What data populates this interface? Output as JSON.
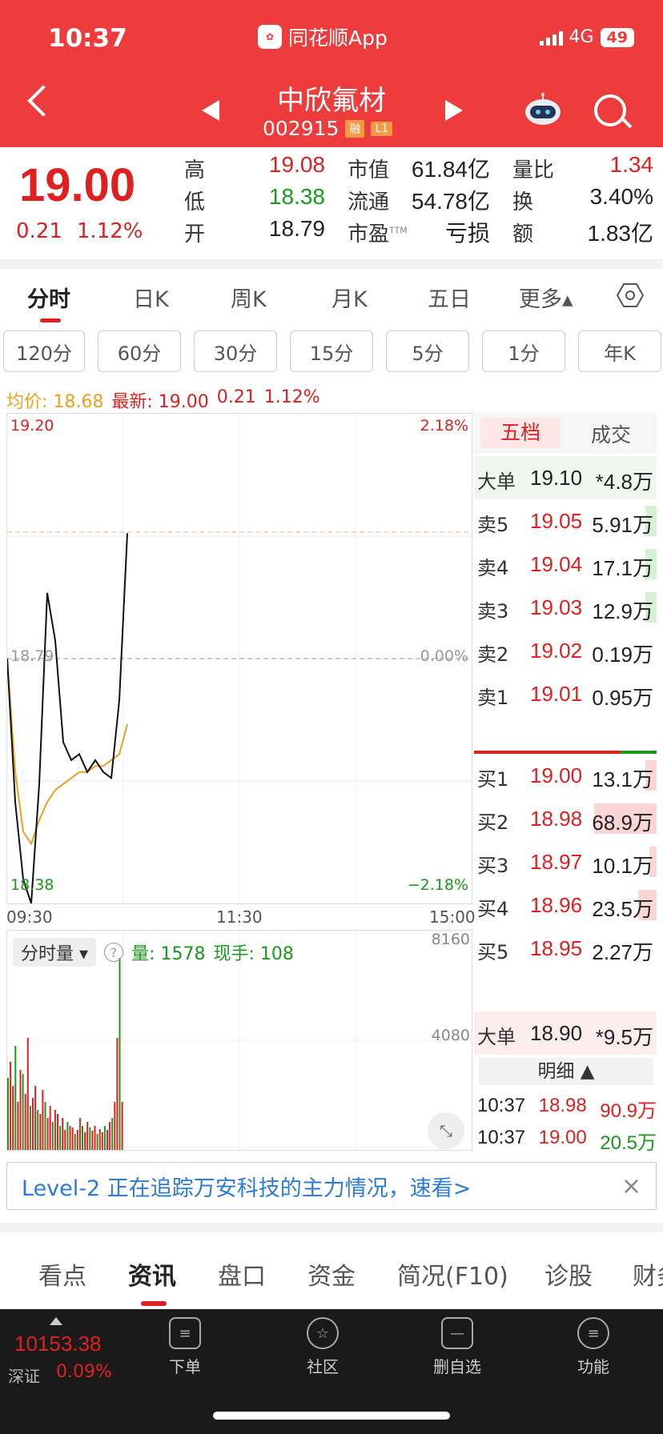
{
  "status": {
    "time": "10:37",
    "app": "同花顺App",
    "network": "4G",
    "battery": "49"
  },
  "stock": {
    "name": "中欣氟材",
    "code": "002915",
    "tag1": "融",
    "tag2": "L1"
  },
  "quote": {
    "price": "19.00",
    "change": "0.21",
    "pct": "1.12%",
    "high_lbl": "高",
    "high": "19.08",
    "low_lbl": "低",
    "low": "18.38",
    "open_lbl": "开",
    "open": "18.79",
    "mktcap_lbl": "市值",
    "mktcap": "61.84亿",
    "float_lbl": "流通",
    "float": "54.78亿",
    "pe_lbl": "市盈",
    "pe_sup": "TTM",
    "pe": "亏损",
    "volratio_lbl": "量比",
    "volratio": "1.34",
    "turnover_lbl": "换",
    "turnover": "3.40%",
    "amount_lbl": "额",
    "amount": "1.83亿"
  },
  "tabs": [
    "分时",
    "日K",
    "周K",
    "月K",
    "五日",
    "更多▴"
  ],
  "periods": [
    "120分",
    "60分",
    "30分",
    "15分",
    "5分",
    "1分",
    "年K"
  ],
  "avg_line": {
    "avg": "均价: 18.68",
    "latest": "最新: 19.00",
    "chg": "0.21",
    "pct": "1.12%"
  },
  "chart": {
    "ymax": "19.20",
    "ymid": "18.79",
    "ymin": "18.38",
    "pmax": "2.18%",
    "pmid": "0.00%",
    "pmin": "−2.18%",
    "t1": "09:30",
    "t2": "11:30",
    "t3": "15:00",
    "vol_max": "8160",
    "vol_mid": "4080",
    "vol_sel": "分时量 ▾",
    "vol_help": "?",
    "vol_lbl": "量: 1578",
    "hand_lbl": "现手: 108"
  },
  "chart_data": {
    "type": "line",
    "title": "",
    "x_range": [
      "09:30",
      "15:00"
    ],
    "ylim": [
      18.38,
      19.2
    ],
    "series": [
      {
        "name": "最新",
        "values": [
          18.79,
          18.55,
          18.42,
          18.38,
          18.58,
          18.9,
          18.82,
          18.65,
          18.62,
          18.63,
          18.6,
          18.62,
          18.6,
          18.59,
          18.72,
          19.0
        ]
      },
      {
        "name": "均价",
        "values": [
          18.79,
          18.6,
          18.5,
          18.48,
          18.52,
          18.55,
          18.57,
          18.58,
          18.59,
          18.6,
          18.6,
          18.61,
          18.61,
          18.62,
          18.63,
          18.68
        ]
      }
    ]
  },
  "orderbook": {
    "tab1": "五档",
    "tab2": "成交",
    "big_sell": {
      "lbl": "大单",
      "p": "19.10",
      "v": "*4.8万"
    },
    "sells": [
      {
        "lbl": "卖5",
        "p": "19.05",
        "v": "5.91万",
        "w": 0.06
      },
      {
        "lbl": "卖4",
        "p": "19.04",
        "v": "17.1万",
        "w": 0.06
      },
      {
        "lbl": "卖3",
        "p": "19.03",
        "v": "12.9万",
        "w": 0.06
      },
      {
        "lbl": "卖2",
        "p": "19.02",
        "v": "0.19万",
        "w": 0.0
      },
      {
        "lbl": "卖1",
        "p": "19.01",
        "v": "0.95万",
        "w": 0.0
      }
    ],
    "buys": [
      {
        "lbl": "买1",
        "p": "19.00",
        "v": "13.1万",
        "w": 0.06
      },
      {
        "lbl": "买2",
        "p": "18.98",
        "v": "68.9万",
        "w": 0.34
      },
      {
        "lbl": "买3",
        "p": "18.97",
        "v": "10.1万",
        "w": 0.04
      },
      {
        "lbl": "买4",
        "p": "18.96",
        "v": "23.5万",
        "w": 0.1
      },
      {
        "lbl": "买5",
        "p": "18.95",
        "v": "2.27万",
        "w": 0.0
      }
    ],
    "big_buy": {
      "lbl": "大单",
      "p": "18.90",
      "v": "*9.5万"
    },
    "mingxi": "明细 ▲",
    "trades": [
      {
        "t": "10:37",
        "p": "18.98",
        "v": "90.9万"
      },
      {
        "t": "10:37",
        "p": "19.00",
        "v": "20.5万"
      }
    ]
  },
  "banner": {
    "text": "Level-2 正在追踪万安科技的主力情况，速看>",
    "close": "×"
  },
  "bottom_tabs": [
    "看点",
    "资讯",
    "盘口",
    "资金",
    "简况(F10)",
    "诊股",
    "财务"
  ],
  "index": {
    "value": "10153.38",
    "name": "深证",
    "pct": "0.09%"
  },
  "bar_items": [
    {
      "label": "下单",
      "icon": "≡"
    },
    {
      "label": "社区",
      "icon": "☆"
    },
    {
      "label": "删自选",
      "icon": "—"
    },
    {
      "label": "功能",
      "icon": "≡"
    }
  ]
}
